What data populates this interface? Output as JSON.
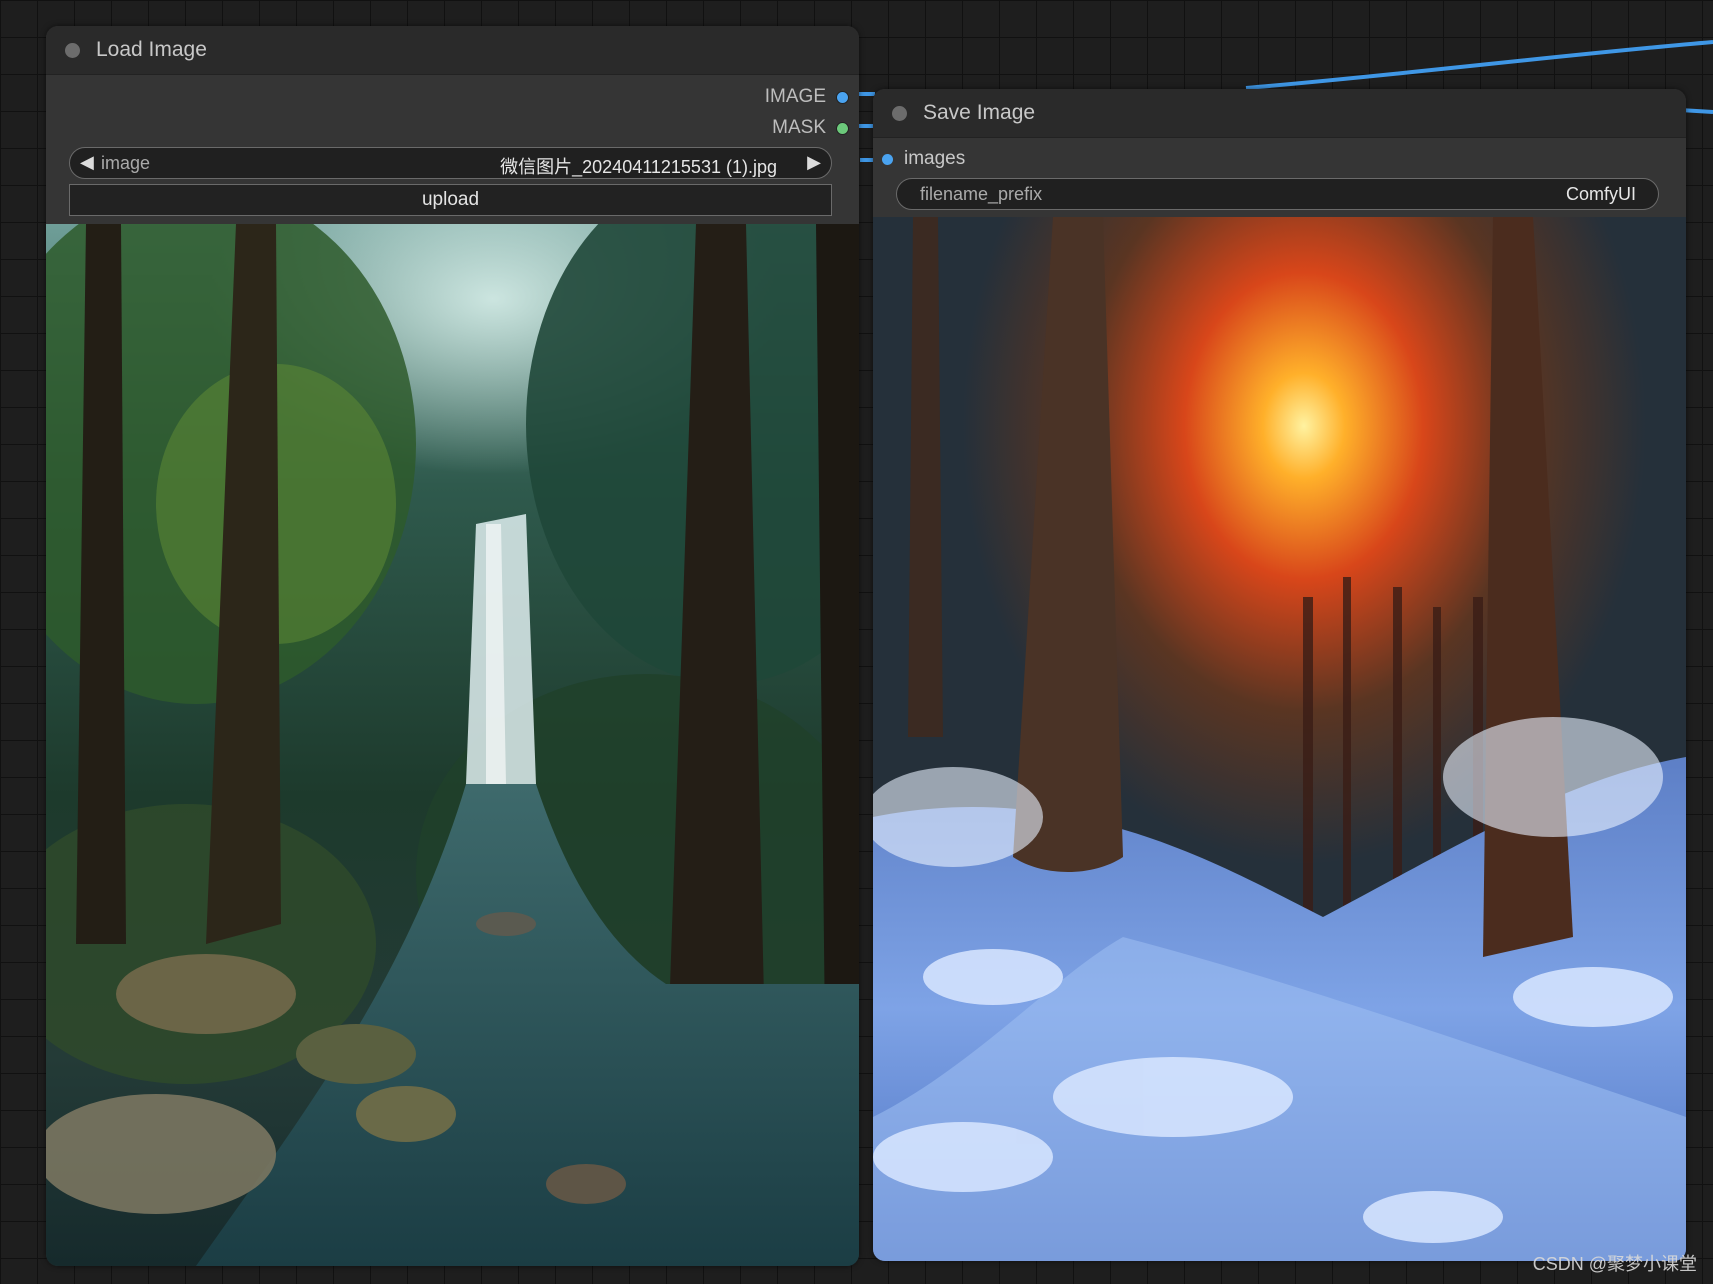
{
  "colors": {
    "image_port": "#4aa3f0",
    "mask_port": "#6cc97b",
    "wire": "#3f97e6"
  },
  "load_node": {
    "title": "Load Image",
    "outputs": [
      {
        "label": "IMAGE"
      },
      {
        "label": "MASK"
      }
    ],
    "image_widget": {
      "label": "image",
      "value": "微信图片_20240411215531 (1).jpg",
      "prev_icon": "◀",
      "next_icon": "▶"
    },
    "upload_label": "upload",
    "preview_icon": "forest-waterfall-image"
  },
  "save_node": {
    "title": "Save Image",
    "input": {
      "label": "images"
    },
    "prefix_widget": {
      "label": "filename_prefix",
      "value": "ComfyUI"
    },
    "preview_icon": "snowy-forest-sunset-image"
  },
  "watermark": "CSDN @聚梦小课堂"
}
